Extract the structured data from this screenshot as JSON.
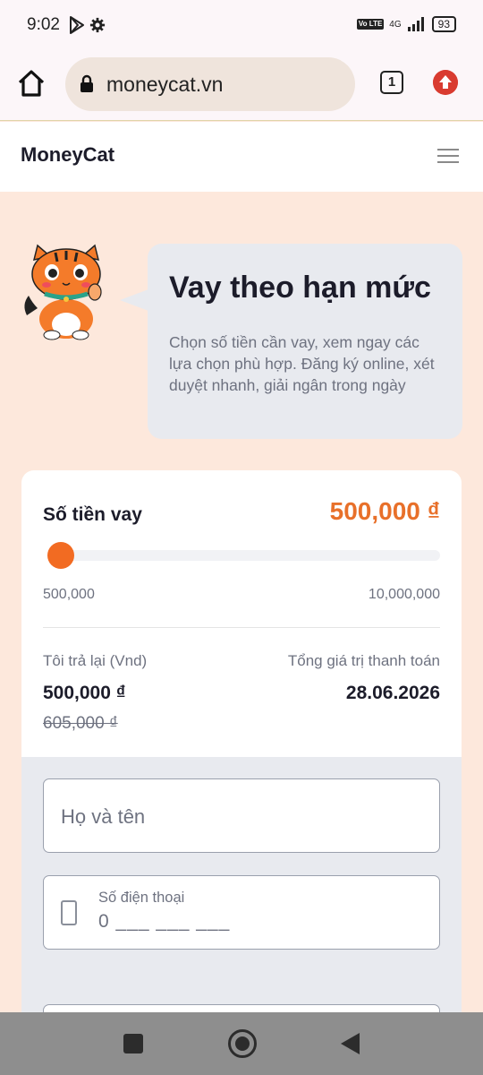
{
  "status_bar": {
    "time": "9:02",
    "volte": "Vo LTE",
    "network": "4G",
    "battery": "93"
  },
  "browser": {
    "url": "moneycat.vn",
    "tab_count": "1"
  },
  "site": {
    "logo": "MoneyCat"
  },
  "hero": {
    "title": "Vay theo hạn mức",
    "description": "Chọn số tiền cần vay, xem ngay các lựa chọn phù hợp. Đăng ký online, xét duyệt nhanh, giải ngân trong ngày"
  },
  "loan": {
    "amount_label": "Số tiền vay",
    "amount_value": "500,000 ₫",
    "slider_min": "500,000",
    "slider_max": "10,000,000",
    "slider_fraction": 0.0,
    "repay_label": "Tôi trả lại (Vnd)",
    "total_label": "Tổng giá trị thanh toán",
    "repay_value": "500,000 ₫",
    "date_value": "28.06.2026",
    "old_value": "605,000 ₫"
  },
  "form": {
    "name_placeholder": "Họ và tên",
    "phone_label": "Số điện thoại",
    "phone_value": "0 ___ ___ ___"
  },
  "colors": {
    "accent": "#e8702a",
    "background": "#fde8dc",
    "bubble": "#e8eaef"
  },
  "icons": [
    "play-store-icon",
    "settings-icon",
    "signal-icon",
    "home-icon",
    "lock-icon",
    "update-icon",
    "menu-icon",
    "phone-icon",
    "nav-recents-icon",
    "nav-home-icon",
    "nav-back-icon"
  ]
}
